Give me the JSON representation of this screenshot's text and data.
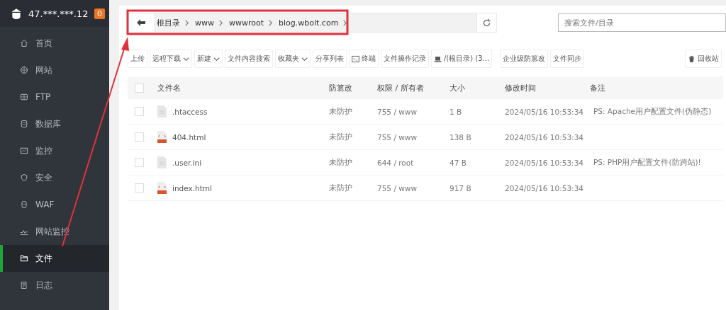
{
  "sidebar": {
    "server": "47.***.***.12",
    "badge": "0",
    "items": [
      {
        "label": "首页",
        "selected": false
      },
      {
        "label": "网站",
        "selected": false
      },
      {
        "label": "FTP",
        "selected": false
      },
      {
        "label": "数据库",
        "selected": false
      },
      {
        "label": "监控",
        "selected": false
      },
      {
        "label": "安全",
        "selected": false
      },
      {
        "label": "WAF",
        "selected": false
      },
      {
        "label": "网站监控",
        "selected": false
      },
      {
        "label": "文件",
        "selected": true
      },
      {
        "label": "日志",
        "selected": false
      }
    ]
  },
  "path_bar": {
    "segments": [
      "根目录",
      "www",
      "wwwroot",
      "blog.wbolt.com"
    ]
  },
  "search": {
    "placeholder": "搜索文件/目录"
  },
  "toolbar": [
    {
      "label": "上传",
      "kind": "button"
    },
    {
      "label": "远程下载",
      "kind": "dropdown"
    },
    {
      "label": "新建",
      "kind": "dropdown"
    },
    {
      "label": "文件内容搜索",
      "kind": "button"
    },
    {
      "label": "收藏夹",
      "kind": "dropdown"
    },
    {
      "label": "分享列表",
      "kind": "button"
    },
    {
      "label": "终端",
      "kind": "terminal"
    },
    {
      "label": "文件操作记录",
      "kind": "button"
    },
    {
      "label": "/(根目录) (3...",
      "kind": "disk"
    },
    {
      "label": "企业级防篡改",
      "kind": "button"
    },
    {
      "label": "文件同步",
      "kind": "button"
    },
    {
      "label": "回收站",
      "kind": "trash"
    }
  ],
  "table": {
    "select_all": {
      "checked": false
    },
    "columns": [
      "文件名",
      "防篡改",
      "权限 / 所有者",
      "大小",
      "修改时间",
      "备注"
    ],
    "rows": [
      {
        "checked": false,
        "kind": "text",
        "name": ".htaccess",
        "protection": "未防护",
        "permission": "755 / www",
        "size": "1 B",
        "modified": "2024/05/16 10:53:34",
        "note": "PS: Apache用户配置文件(伪静态)"
      },
      {
        "checked": false,
        "kind": "html",
        "name": "404.html",
        "protection": "未防护",
        "permission": "755 / www",
        "size": "138 B",
        "modified": "2024/05/16 10:53:34",
        "note": ""
      },
      {
        "checked": false,
        "kind": "text",
        "name": ".user.ini",
        "protection": "未防护",
        "permission": "644 / root",
        "size": "47 B",
        "modified": "2024/05/16 10:53:34",
        "note": "PS: PHP用户配置文件(防跨站)!"
      },
      {
        "checked": false,
        "kind": "html",
        "name": "index.html",
        "protection": "未防护",
        "permission": "755 / www",
        "size": "917 B",
        "modified": "2024/05/16 10:53:34",
        "note": ""
      }
    ]
  }
}
